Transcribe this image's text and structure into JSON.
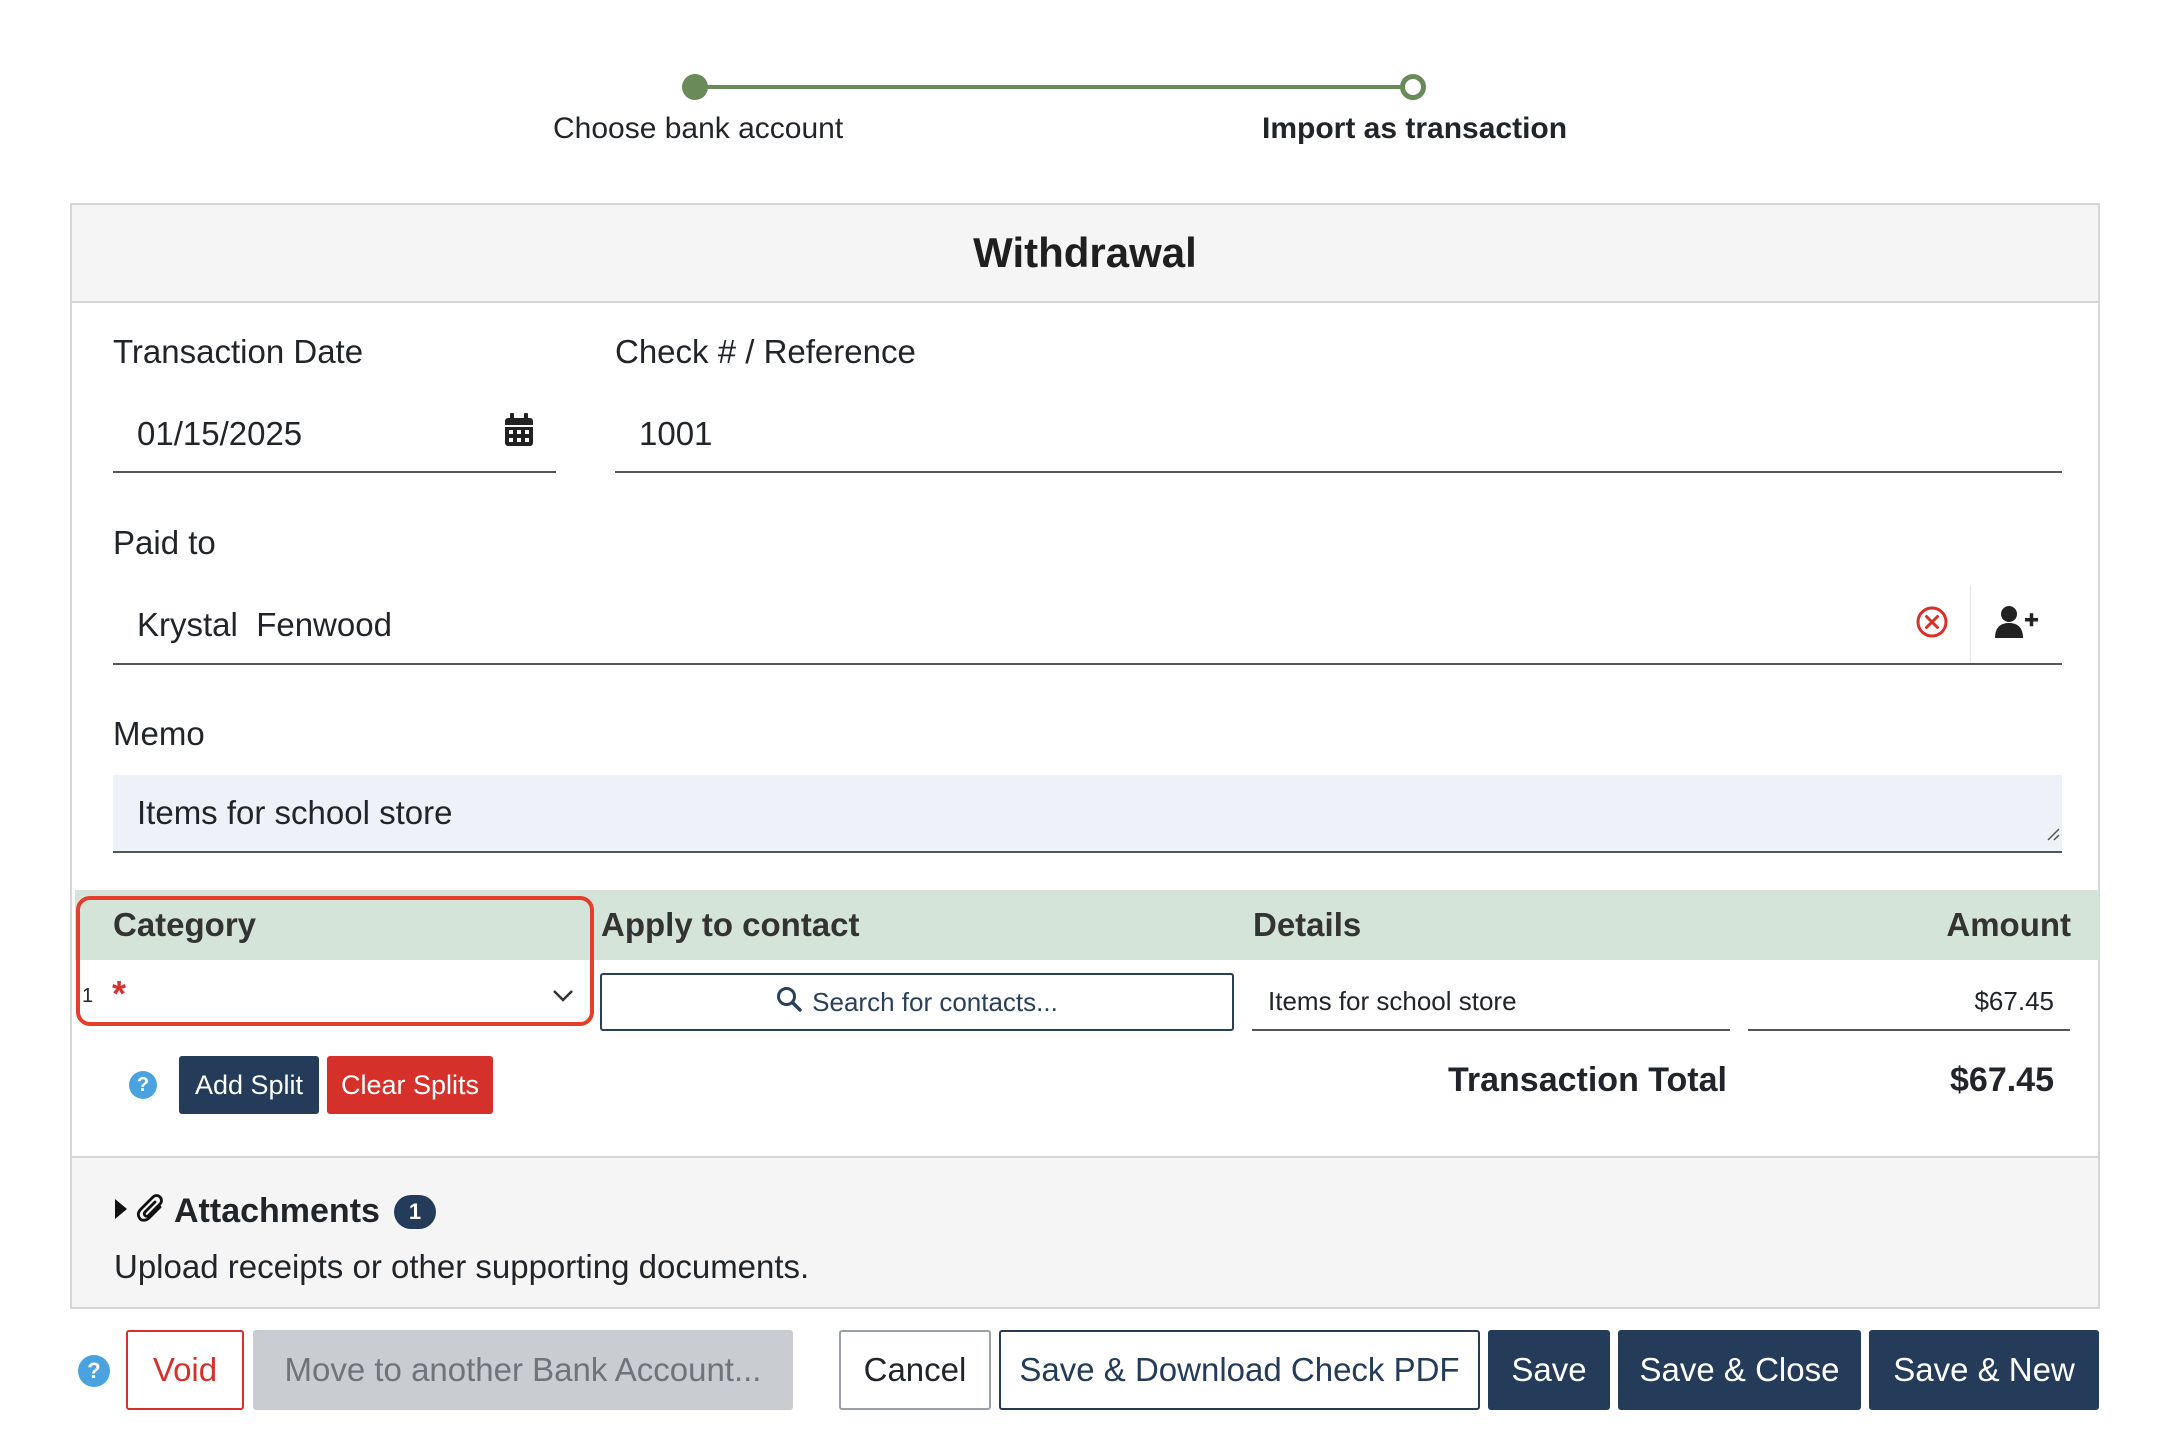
{
  "stepper": {
    "steps": [
      {
        "label": "Choose bank account",
        "state": "complete"
      },
      {
        "label": "Import as transaction",
        "state": "current"
      }
    ]
  },
  "form": {
    "title": "Withdrawal",
    "transaction_date": {
      "label": "Transaction Date",
      "value": "01/15/2025"
    },
    "reference": {
      "label": "Check # / Reference",
      "value": "1001"
    },
    "paid_to": {
      "label": "Paid to",
      "value": "Krystal  Fenwood"
    },
    "memo": {
      "label": "Memo",
      "value": "Items for school store"
    }
  },
  "splits": {
    "columns": {
      "category": "Category",
      "contact": "Apply to contact",
      "details": "Details",
      "amount": "Amount"
    },
    "rows": [
      {
        "index": "1",
        "required_mark": "*",
        "contact_placeholder": "Search for contacts...",
        "details": "Items for school store",
        "amount": "$67.45"
      }
    ],
    "help": "?",
    "add_split": "Add Split",
    "clear_splits": "Clear Splits",
    "total_label": "Transaction Total",
    "total_value": "$67.45"
  },
  "attachments": {
    "title": "Attachments",
    "count": "1",
    "description": "Upload receipts or other supporting documents."
  },
  "footer": {
    "help": "?",
    "void": "Void",
    "move": "Move to another Bank Account...",
    "cancel": "Cancel",
    "download": "Save & Download Check PDF",
    "save": "Save",
    "save_close": "Save & Close",
    "save_new": "Save & New"
  },
  "colors": {
    "step_green": "#6b8a5a",
    "navy": "#243b5a",
    "danger": "#d6302b",
    "split_header": "#d5e4d8",
    "highlight": "#e53e2b",
    "help_blue": "#4aa3df"
  },
  "icons": [
    "calendar-icon",
    "clear-circle-icon",
    "add-person-icon",
    "resize-grip-icon",
    "chevron-down-icon",
    "search-icon",
    "caret-right-icon",
    "paperclip-icon",
    "help-icon"
  ]
}
